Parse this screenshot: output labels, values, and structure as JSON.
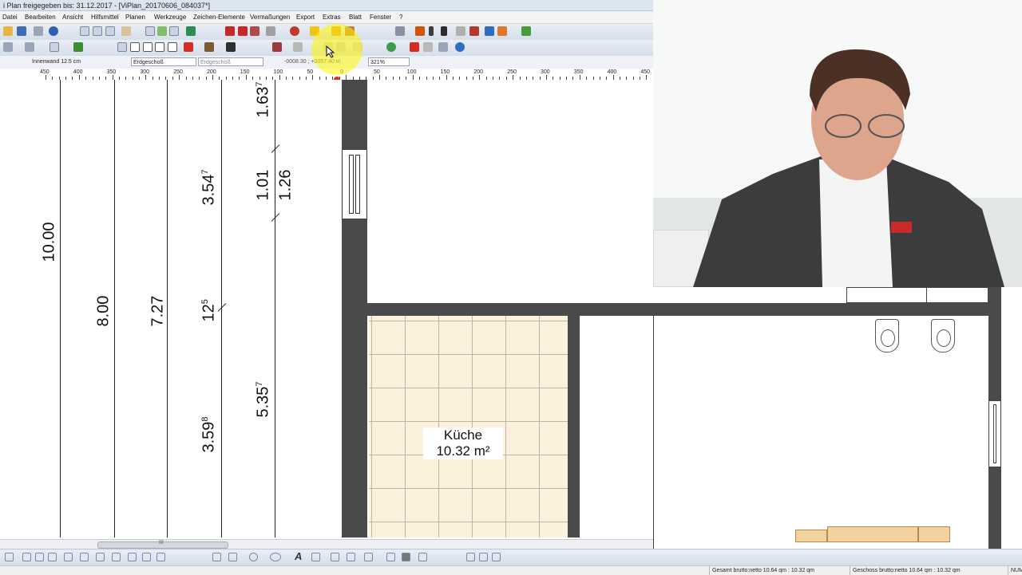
{
  "window": {
    "title": "i Plan freigegeben bis: 31.12.2017 - [ViPlan_20170606_084037*]"
  },
  "menu": [
    "Datei",
    "Bearbeiten",
    "Ansicht",
    "Hilfsmittel",
    "Planen",
    "Werkzeuge",
    "Zeichen-Elemente",
    "Vermaßungen",
    "Export",
    "Extras",
    "Blatt",
    "Fenster",
    "?"
  ],
  "properties": {
    "element": "Innenwand 12.5 cm",
    "floor": "Erdgeschoß",
    "floor_ref": "Erdgeschoß",
    "coordinates": "-0008.30 ; +0057.40 m",
    "zoom": "321%"
  },
  "ruler": {
    "labels": [
      "450",
      "400",
      "350",
      "300",
      "250",
      "200",
      "150",
      "100",
      "50",
      "0",
      "50",
      "100",
      "150",
      "200",
      "250",
      "300",
      "350",
      "400",
      "450"
    ]
  },
  "dimensions": {
    "d_10_00": "10.00",
    "d_8_00": "8.00",
    "d_7_27": "7.27",
    "d_3_54": "3.54",
    "d_3_54_sup": "7",
    "d_12": "12",
    "d_12_sup": "5",
    "d_3_59": "3.59",
    "d_3_59_sup": "8",
    "d_1_63": "1.63",
    "d_1_63_sup": "7",
    "d_1_01": "1.01",
    "d_1_26": "1.26",
    "d_5_35": "5.35",
    "d_5_35_sup": "7"
  },
  "room": {
    "name": "Küche",
    "area": "10.32 m²"
  },
  "scrollbar": {
    "grip": "III"
  },
  "status": {
    "gesamt": "Gesamt brutto:netto 10.64 qm : 10.32 qm",
    "geschoss": "Geschoss brutto:netto 10.64 qm : 10.32 qm",
    "num": "NUM"
  },
  "colors": {
    "tile": "#fbf1dc",
    "wall": "#4a4a4a",
    "highlight": "#fff200",
    "cursor_dot": "#e0302a"
  }
}
